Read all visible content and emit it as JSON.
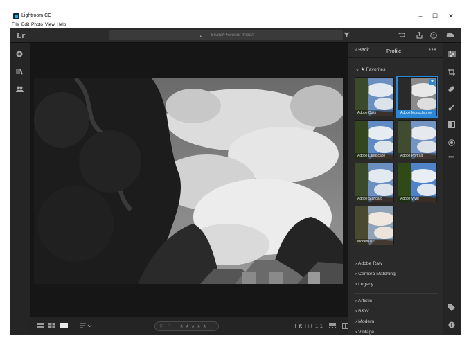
{
  "window": {
    "title": "Lightroom CC",
    "minimize": "–",
    "maximize": "☐",
    "close": "✕"
  },
  "menu": [
    "File",
    "Edit",
    "Photo",
    "View",
    "Help"
  ],
  "topbar": {
    "logo": "Lr",
    "search_placeholder": "Search Recent Import"
  },
  "panel": {
    "back_label": "Back",
    "title": "Profile",
    "more": "•••",
    "favorites_label": "Favorites",
    "profiles": [
      {
        "label": "Adobe Color",
        "selected": false
      },
      {
        "label": "Adobe Monochrome",
        "selected": true
      },
      {
        "label": "Adobe Landscape",
        "selected": false
      },
      {
        "label": "Adobe Portrait",
        "selected": false
      },
      {
        "label": "Adobe Standard",
        "selected": false
      },
      {
        "label": "Adobe Vivid",
        "selected": false
      },
      {
        "label": "Modern 07",
        "selected": false
      }
    ],
    "groups1": [
      "Adobe Raw",
      "Camera Matching",
      "Legacy"
    ],
    "groups2": [
      "Artistic",
      "B&W",
      "Modern",
      "Vintage"
    ]
  },
  "bottombar": {
    "fit": "Fit",
    "fill": "Fill",
    "one_to_one": "1:1"
  },
  "colors": {
    "accent": "#2a86d6",
    "window_border": "#1a8fd1"
  }
}
